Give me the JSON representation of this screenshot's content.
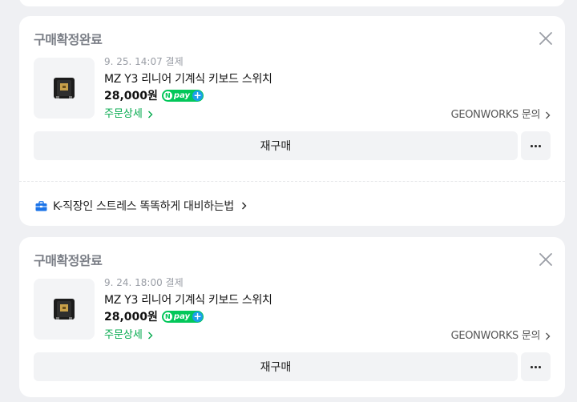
{
  "orders": [
    {
      "status": "구매확정완료",
      "datetime": "9. 25. 14:07 결제",
      "product_name": "MZ Y3 리니어 기계식 키보드 스위치",
      "price": "28,000원",
      "npay_label": "pay",
      "detail_label": "주문상세",
      "seller_label": "GEONWORKS 문의",
      "rebuy_label": "재구매",
      "promo_label": "K-직장인 스트레스 똑똑하게 대비하는법"
    },
    {
      "status": "구매확정완료",
      "datetime": "9. 24. 18:00 결제",
      "product_name": "MZ Y3 리니어 기계식 키보드 스위치",
      "price": "28,000원",
      "npay_label": "pay",
      "detail_label": "주문상세",
      "seller_label": "GEONWORKS 문의",
      "rebuy_label": "재구매"
    }
  ],
  "colors": {
    "accent_green": "#03c75a",
    "npay_plus_blue": "#1a9fe9",
    "background": "#eff0f3"
  },
  "icons": [
    "close-icon",
    "briefcase-icon",
    "chevron-right-icon",
    "more-dots-icon",
    "npay-logo"
  ]
}
